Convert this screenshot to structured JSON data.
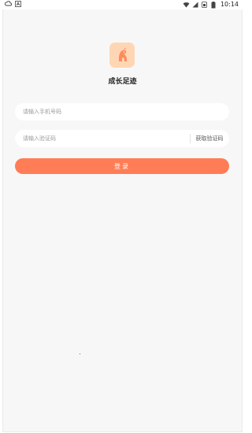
{
  "status_bar": {
    "time": "10:14",
    "left_icons": [
      "cloud-icon",
      "a-icon"
    ],
    "right_icons": [
      "wifi-icon",
      "signal-icon",
      "sim-icon",
      "battery-icon"
    ]
  },
  "app": {
    "title": "成长足迹",
    "logo_icon": "elephant-icon"
  },
  "form": {
    "phone_placeholder": "请输入手机号码",
    "code_placeholder": "请输入验证码",
    "get_code_label": "获取验证码",
    "login_label": "登录"
  },
  "colors": {
    "accent": "#ff7d56",
    "logo_bg": "#ffd6b4",
    "page_bg": "#f7f7f7"
  }
}
